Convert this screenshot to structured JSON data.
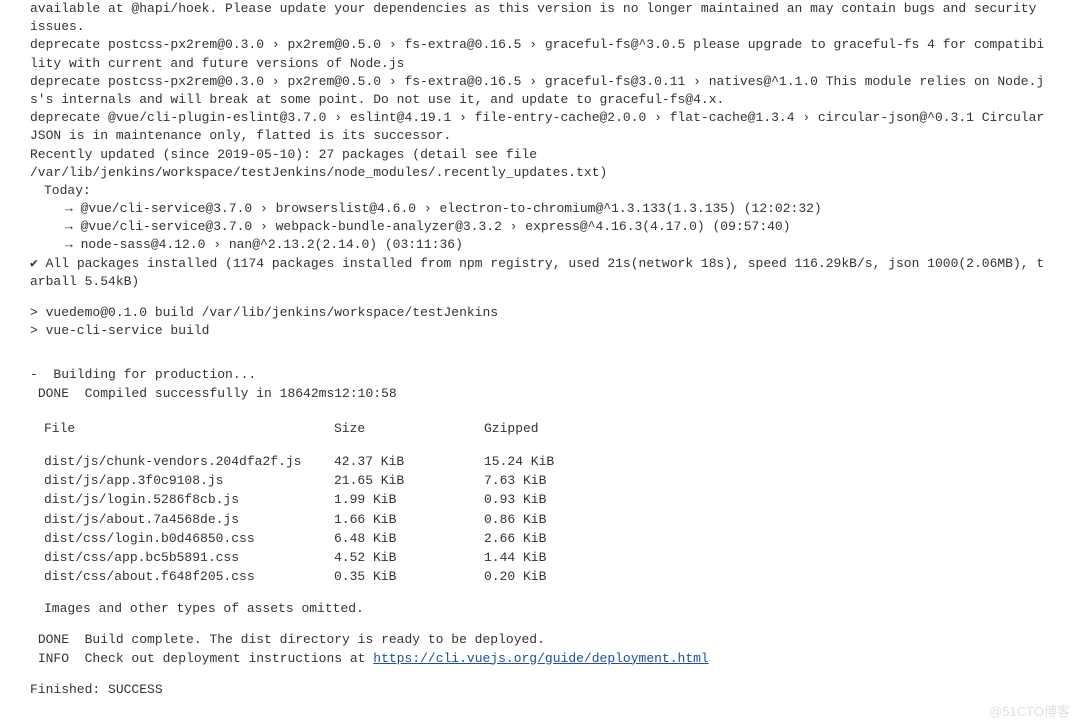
{
  "lines": {
    "dep_hoek": "available at @hapi/hoek. Please update your dependencies as this version is no longer maintained an may contain bugs and security issues.",
    "dep_gfs1": "deprecate postcss-px2rem@0.3.0 › px2rem@0.5.0 › fs-extra@0.16.5 › graceful-fs@^3.0.5 please upgrade to graceful-fs 4 for compatibility with current and future versions of Node.js",
    "dep_gfs2": "deprecate postcss-px2rem@0.3.0 › px2rem@0.5.0 › fs-extra@0.16.5 › graceful-fs@3.0.11 › natives@^1.1.0 This module relies on Node.js's internals and will break at some point. Do not use it, and update to graceful-fs@4.x.",
    "dep_circ": "deprecate @vue/cli-plugin-eslint@3.7.0 › eslint@4.19.1 › file-entry-cache@2.0.0 › flat-cache@1.3.4 › circular-json@^0.3.1 CircularJSON is in maintenance only, flatted is its successor.",
    "recent1": "Recently updated (since 2019-05-10): 27 packages (detail see file",
    "recent2": "/var/lib/jenkins/workspace/testJenkins/node_modules/.recently_updates.txt)",
    "today": "Today:",
    "pkg1": "→ @vue/cli-service@3.7.0 › browserslist@4.6.0 › electron-to-chromium@^1.3.133(1.3.135) (12:02:32)",
    "pkg2": "→ @vue/cli-service@3.7.0 › webpack-bundle-analyzer@3.3.2 › express@^4.16.3(4.17.0) (09:57:40)",
    "pkg3": "→ node-sass@4.12.0 › nan@^2.13.2(2.14.0) (03:11:36)",
    "allpkg": "✔ All packages installed (1174 packages installed from npm registry, used 21s(network 18s), speed 116.29kB/s, json 1000(2.06MB), tarball 5.54kB)",
    "buildcmd1": "> vuedemo@0.1.0 build /var/lib/jenkins/workspace/testJenkins",
    "buildcmd2": "> vue-cli-service build",
    "building": "-  Building for production...",
    "done_compile": " DONE  Compiled successfully in 18642ms12:10:58",
    "hdr_file": "File",
    "hdr_size": "Size",
    "hdr_gzip": "Gzipped",
    "omitted": "Images and other types of assets omitted.",
    "done_build": " DONE  Build complete. The dist directory is ready to be deployed.",
    "info_deploy_pre": " INFO  Check out deployment instructions at ",
    "deploy_url": "https://cli.vuejs.org/guide/deployment.html",
    "finished": "Finished: SUCCESS"
  },
  "files": [
    {
      "file": "dist/js/chunk-vendors.204dfa2f.js",
      "size": "42.37 KiB",
      "gzip": "15.24 KiB"
    },
    {
      "file": "dist/js/app.3f0c9108.js",
      "size": "21.65 KiB",
      "gzip": "7.63 KiB"
    },
    {
      "file": "dist/js/login.5286f8cb.js",
      "size": "1.99 KiB",
      "gzip": "0.93 KiB"
    },
    {
      "file": "dist/js/about.7a4568de.js",
      "size": "1.66 KiB",
      "gzip": "0.86 KiB"
    },
    {
      "file": "dist/css/login.b0d46850.css",
      "size": "6.48 KiB",
      "gzip": "2.66 KiB"
    },
    {
      "file": "dist/css/app.bc5b5891.css",
      "size": "4.52 KiB",
      "gzip": "1.44 KiB"
    },
    {
      "file": "dist/css/about.f648f205.css",
      "size": "0.35 KiB",
      "gzip": "0.20 KiB"
    }
  ],
  "watermark": "@51CTO博客"
}
